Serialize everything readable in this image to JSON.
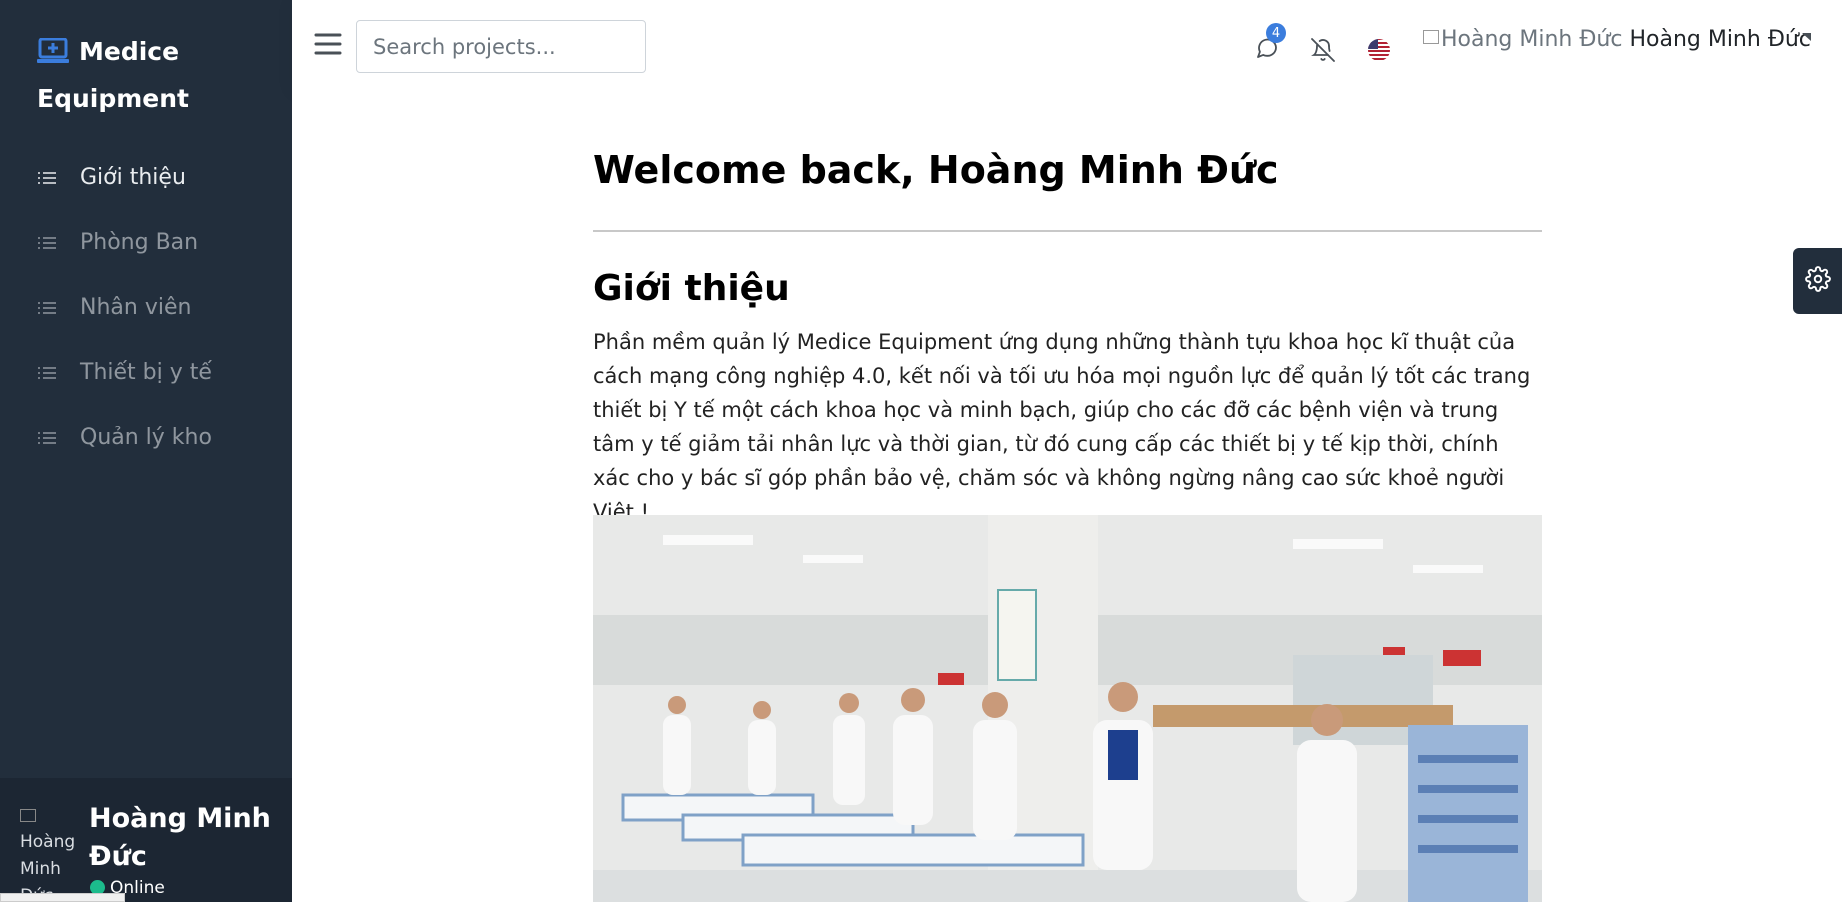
{
  "brand": {
    "name": "Medice Equipment",
    "icon": "laptop-medical-icon"
  },
  "sidebar": {
    "items": [
      {
        "label": "Giới thiệu",
        "icon": "list-icon",
        "active": true
      },
      {
        "label": "Phòng Ban",
        "icon": "list-icon"
      },
      {
        "label": "Nhân viên",
        "icon": "list-icon"
      },
      {
        "label": "Thiết bị y tế",
        "icon": "list-icon"
      },
      {
        "label": "Quản lý kho",
        "icon": "list-icon"
      }
    ],
    "user": {
      "avatar_alt": "Hoàng Minh Đức",
      "name": "Hoàng Minh Đức",
      "status": "Online"
    }
  },
  "topbar": {
    "search": {
      "placeholder": "Search projects..."
    },
    "messages_count": "4",
    "user": {
      "avatar_alt": "Hoàng Minh Đức",
      "name": "Hoàng Minh Đức"
    }
  },
  "main": {
    "welcome": "Welcome back, Hoàng Minh Đức",
    "section_title": "Giới thiệu",
    "description": "Phần mềm quản lý Medice Equipment ứng dụng những thành tựu khoa học kĩ thuật của cách mạng công nghiệp 4.0, kết nối và tối ưu hóa mọi nguồn lực để quản lý tốt các trang thiết bị Y tế một cách khoa học và minh bạch, giúp cho các đỡ các bệnh viện và trung tâm y tế giảm tải nhân lực và thời gian, từ đó cung cấp các thiết bị y tế kịp thời, chính xác cho y bác sĩ góp phần bảo vệ, chăm sóc và không ngừng nâng cao sức khoẻ người Việt !"
  },
  "colors": {
    "sidebar": "#222e3c",
    "accent": "#3b7ddd",
    "online": "#1cbb8c"
  }
}
